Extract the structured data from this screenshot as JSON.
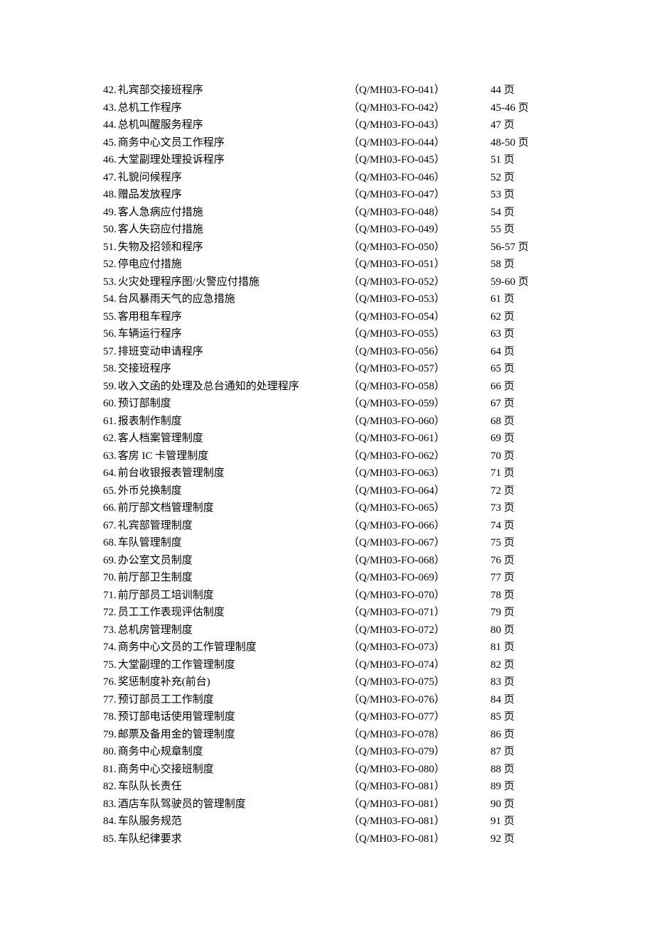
{
  "toc": [
    {
      "num": "42",
      "title": "礼宾部交接班程序",
      "code": "（Q/MH03-FO-041）",
      "page": "44 页"
    },
    {
      "num": "43",
      "title": "总机工作程序",
      "code": "（Q/MH03-FO-042）",
      "page": "45-46 页"
    },
    {
      "num": "44",
      "title": "总机叫醒服务程序",
      "code": "（Q/MH03-FO-043）",
      "page": "47 页"
    },
    {
      "num": "45",
      "title": "商务中心文员工作程序",
      "code": "（Q/MH03-FO-044）",
      "page": "48-50 页"
    },
    {
      "num": "46",
      "title": "大堂副理处理投诉程序",
      "code": "（Q/MH03-FO-045）",
      "page": "51 页"
    },
    {
      "num": "47",
      "title": "礼貌问候程序",
      "code": "（Q/MH03-FO-046）",
      "page": "52 页"
    },
    {
      "num": "48",
      "title": "赠品发放程序",
      "code": "（Q/MH03-FO-047）",
      "page": "53 页"
    },
    {
      "num": "49",
      "title": "客人急病应付措施",
      "code": "（Q/MH03-FO-048）",
      "page": "54 页"
    },
    {
      "num": "50",
      "title": "客人失窃应付措施",
      "code": "（Q/MH03-FO-049）",
      "page": "55 页"
    },
    {
      "num": "51",
      "title": "失物及招领和程序",
      "code": "（Q/MH03-FO-050）",
      "page": "56-57 页"
    },
    {
      "num": "52",
      "title": "停电应付措施",
      "code": "（Q/MH03-FO-051）",
      "page": "58 页"
    },
    {
      "num": "53",
      "title": "火灾处理程序图/火警应付措施",
      "code": "（Q/MH03-FO-052）",
      "page": "59-60 页"
    },
    {
      "num": "54",
      "title": "台风暴雨天气的应急措施",
      "code": "（Q/MH03-FO-053）",
      "page": "61 页"
    },
    {
      "num": "55",
      "title": "客用租车程序",
      "code": "（Q/MH03-FO-054）",
      "page": "62 页"
    },
    {
      "num": "56",
      "title": "车辆运行程序",
      "code": "（Q/MH03-FO-055）",
      "page": "63 页"
    },
    {
      "num": "57",
      "title": "排班变动申请程序",
      "code": "（Q/MH03-FO-056）",
      "page": "64 页"
    },
    {
      "num": "58",
      "title": "交接班程序",
      "code": "（Q/MH03-FO-057）",
      "page": "65 页"
    },
    {
      "num": "59",
      "title": "收入文函的处理及总台通知的处理程序",
      "code": "（Q/MH03-FO-058）",
      "page": "66 页"
    },
    {
      "num": "60",
      "title": "预订部制度",
      "code": "（Q/MH03-FO-059）",
      "page": "67 页"
    },
    {
      "num": "61",
      "title": "报表制作制度",
      "code": "（Q/MH03-FO-060）",
      "page": "68 页"
    },
    {
      "num": "62",
      "title": "客人档案管理制度",
      "code": "（Q/MH03-FO-061）",
      "page": "69 页"
    },
    {
      "num": "63",
      "title": "客房 IC 卡管理制度",
      "code": "（Q/MH03-FO-062）",
      "page": "70 页"
    },
    {
      "num": "64",
      "title": "前台收银报表管理制度",
      "code": "（Q/MH03-FO-063）",
      "page": "71 页"
    },
    {
      "num": "65",
      "title": "外币兑换制度",
      "code": "（Q/MH03-FO-064）",
      "page": "72 页"
    },
    {
      "num": "66",
      "title": "前厅部文档管理制度",
      "code": "（Q/MH03-FO-065）",
      "page": "73 页"
    },
    {
      "num": "67",
      "title": "礼宾部管理制度",
      "code": "（Q/MH03-FO-066）",
      "page": "74 页"
    },
    {
      "num": "68",
      "title": "车队管理制度",
      "code": "（Q/MH03-FO-067）",
      "page": "75 页"
    },
    {
      "num": "69",
      "title": "办公室文员制度",
      "code": "（Q/MH03-FO-068）",
      "page": "76 页"
    },
    {
      "num": "70",
      "title": "前厅部卫生制度",
      "code": "（Q/MH03-FO-069）",
      "page": "77 页"
    },
    {
      "num": "71",
      "title": "前厅部员工培训制度",
      "code": "（Q/MH03-FO-070）",
      "page": "78 页"
    },
    {
      "num": "72",
      "title": "员工工作表现评估制度",
      "code": "（Q/MH03-FO-071）",
      "page": "79 页"
    },
    {
      "num": "73",
      "title": "总机房管理制度",
      "code": "（Q/MH03-FO-072）",
      "page": "80 页"
    },
    {
      "num": "74",
      "title": "商务中心文员的工作管理制度",
      "code": "（Q/MH03-FO-073）",
      "page": "81 页"
    },
    {
      "num": "75",
      "title": "大堂副理的工作管理制度",
      "code": "（Q/MH03-FO-074）",
      "page": "82 页"
    },
    {
      "num": "76",
      "title": "奖惩制度补充(前台)",
      "code": "（Q/MH03-FO-075）",
      "page": "83 页"
    },
    {
      "num": "77",
      "title": "预订部员工工作制度",
      "code": "（Q/MH03-FO-076）",
      "page": "84 页"
    },
    {
      "num": "78",
      "title": "预订部电话使用管理制度",
      "code": "（Q/MH03-FO-077）",
      "page": "85 页"
    },
    {
      "num": "79",
      "title": "邮票及备用金的管理制度",
      "code": "（Q/MH03-FO-078）",
      "page": "86 页"
    },
    {
      "num": "80",
      "title": "商务中心规章制度",
      "code": "（Q/MH03-FO-079）",
      "page": "87 页"
    },
    {
      "num": "81",
      "title": "商务中心交接班制度",
      "code": "（Q/MH03-FO-080）",
      "page": "88 页"
    },
    {
      "num": "82",
      "title": "车队队长责任",
      "code": "（Q/MH03-FO-081）",
      "page": "89 页"
    },
    {
      "num": "83",
      "title": "酒店车队驾驶员的管理制度",
      "code": "（Q/MH03-FO-081）",
      "page": "90 页"
    },
    {
      "num": "84",
      "title": "车队服务规范",
      "code": "（Q/MH03-FO-081）",
      "page": "91 页"
    },
    {
      "num": "85",
      "title": "车队纪律要求",
      "code": "（Q/MH03-FO-081）",
      "page": "92 页"
    }
  ]
}
